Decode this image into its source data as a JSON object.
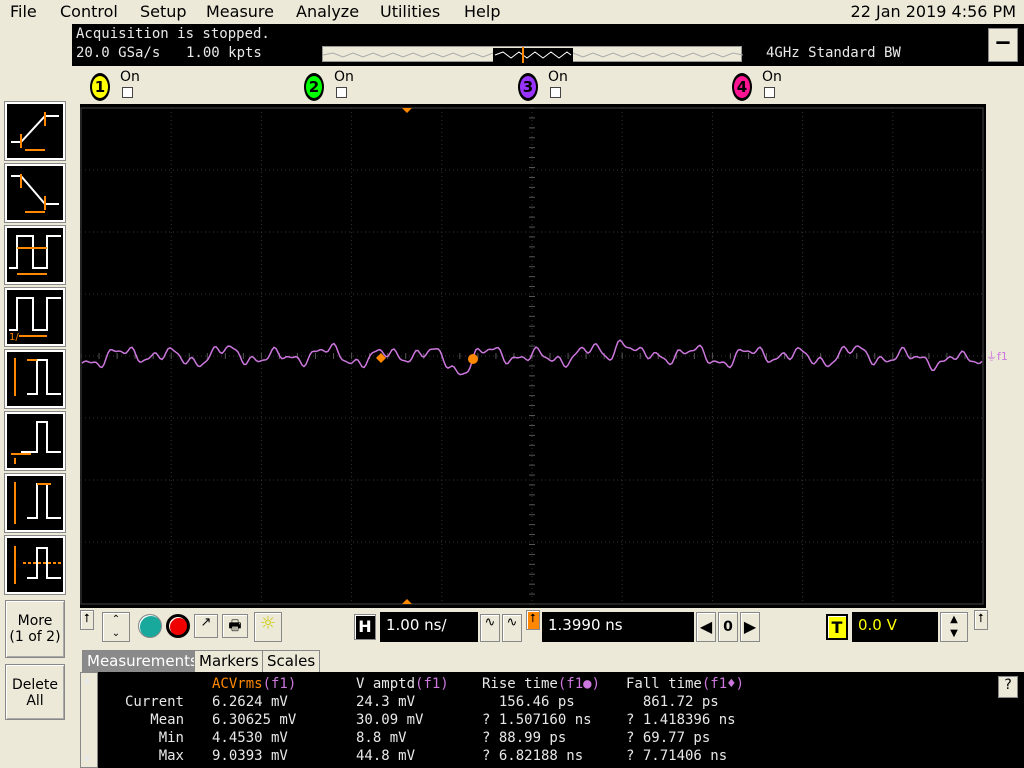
{
  "menu": {
    "items": [
      "File",
      "Control",
      "Setup",
      "Measure",
      "Analyze",
      "Utilities",
      "Help"
    ],
    "datetime": "22 Jan 2019  4:56 PM"
  },
  "status": {
    "line1": "Acquisition is stopped.",
    "sample_rate": "20.0 GSa/s",
    "points": "1.00 kpts",
    "bandwidth": "4GHz Standard BW",
    "minimize": "—"
  },
  "channels": [
    {
      "num": "1",
      "label": "On",
      "color": "#ffff00"
    },
    {
      "num": "2",
      "label": "On",
      "color": "#00ff00"
    },
    {
      "num": "3",
      "label": "On",
      "color": "#9933ff"
    },
    {
      "num": "4",
      "label": "On",
      "color": "#ff1493"
    }
  ],
  "sidebar": {
    "more_label": "More",
    "more_page": "(1 of 2)",
    "delete_label": "Delete",
    "delete_label2": "All"
  },
  "waveform": {
    "label": "f1",
    "color": "#cc77dd"
  },
  "controls": {
    "h_label": "H",
    "timebase": "1.00 ns/",
    "delay": "1.3990 ns",
    "zero": "0",
    "t_label": "T",
    "trigger_level": "0.0 V"
  },
  "tabs": [
    "Measurements",
    "Markers",
    "Scales"
  ],
  "measurements": {
    "headers": [
      {
        "name": "ACVrms",
        "src": "(f1)"
      },
      {
        "name": "V amptd",
        "src": "(f1)"
      },
      {
        "name": "Rise time",
        "src": "(f1●)"
      },
      {
        "name": "Fall time",
        "src": "(f1♦)"
      }
    ],
    "rows": [
      {
        "label": "Current",
        "values": [
          "6.2624 mV",
          "24.3 mV",
          "  156.46 ps",
          "  861.72 ps"
        ]
      },
      {
        "label": "Mean",
        "values": [
          "6.30625 mV",
          "30.09 mV",
          "? 1.507160 ns",
          "? 1.418396 ns"
        ]
      },
      {
        "label": "Min",
        "values": [
          "4.4530 mV",
          "8.8 mV",
          "? 88.99 ps",
          "? 69.77 ps"
        ]
      },
      {
        "label": "Max",
        "values": [
          "9.0393 mV",
          "44.8 mV",
          "? 6.82188 ns",
          "? 7.71406 ns"
        ]
      }
    ],
    "help": "?"
  }
}
